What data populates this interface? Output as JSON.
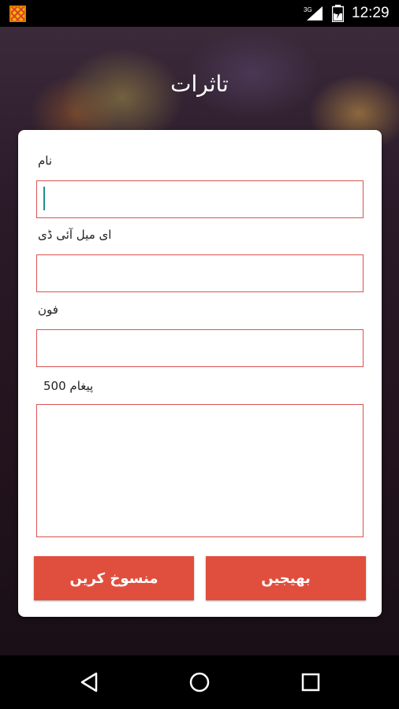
{
  "status_bar": {
    "network_label": "3G",
    "time": "12:29"
  },
  "page": {
    "title": "تاثرات"
  },
  "form": {
    "name_label": "نام",
    "name_value": "",
    "email_label": "ای میل آئی ڈی",
    "email_value": "",
    "phone_label": "فون",
    "phone_value": "",
    "message_label": "پیغام 500",
    "message_value": ""
  },
  "buttons": {
    "cancel_label": "منسوخ کریں",
    "send_label": "بھیجیں"
  },
  "colors": {
    "accent": "#e04f3d",
    "field_border": "#d9534f",
    "cursor": "#1f8f8a"
  },
  "nav_bar": {
    "icons": [
      "back-icon",
      "home-icon",
      "recents-icon"
    ]
  }
}
